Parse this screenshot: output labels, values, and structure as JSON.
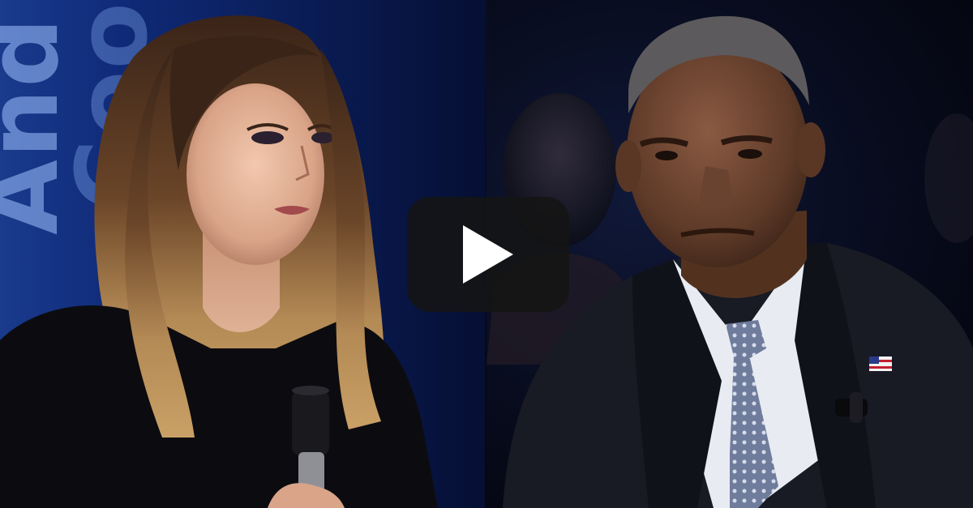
{
  "video": {
    "backdrop_text_line1": "And",
    "backdrop_text_line2": "Coo",
    "play_button_icon": "play-icon",
    "colors": {
      "backdrop_blue": "#1a3a8c",
      "play_button_bg": "#141414",
      "play_icon": "#ffffff"
    }
  }
}
